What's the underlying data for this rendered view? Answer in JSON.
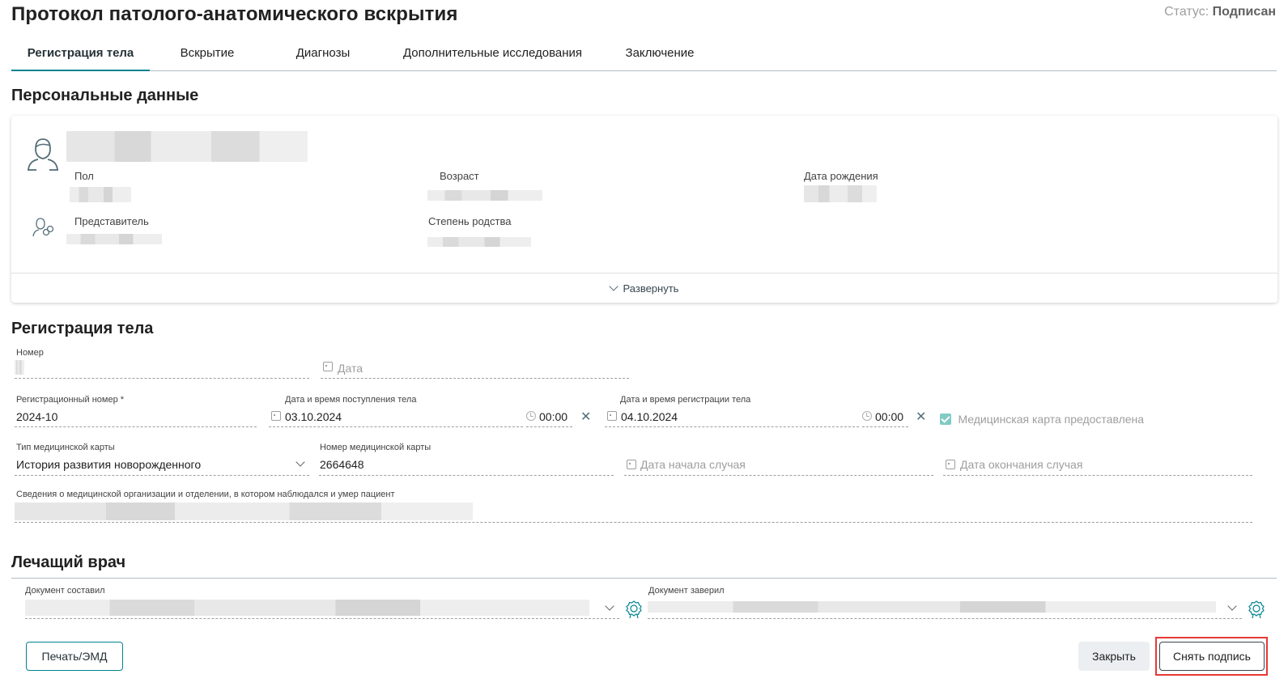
{
  "header": {
    "title": "Протокол патолого-анатомического вскрытия",
    "status_label": "Статус:",
    "status_value": "Подписан"
  },
  "tabs": [
    {
      "label": "Регистрация тела",
      "active": true
    },
    {
      "label": "Вскрытие",
      "active": false
    },
    {
      "label": "Диагнозы",
      "active": false
    },
    {
      "label": "Дополнительные исследования",
      "active": false
    },
    {
      "label": "Заключение",
      "active": false
    }
  ],
  "personal": {
    "section_title": "Персональные данные",
    "sex_label": "Пол",
    "age_label": "Возраст",
    "dob_label": "Дата рождения",
    "representative_label": "Представитель",
    "relation_label": "Степень родства",
    "expand_label": "Развернуть"
  },
  "body_registration": {
    "section_title": "Регистрация тела",
    "number_label": "Номер",
    "date_placeholder": "Дата",
    "reg_number_label": "Регистрационный номер *",
    "reg_number_value": "2024-10",
    "arrival_label": "Дата и время поступления тела",
    "arrival_date": "03.10.2024",
    "arrival_time": "00:00",
    "registration_label": "Дата и время регистрации тела",
    "registration_date": "04.10.2024",
    "registration_time": "00:00",
    "med_card_provided_label": "Медицинская карта предоставлена",
    "med_card_provided": true,
    "card_type_label": "Тип медицинской карты",
    "card_type_value": "История развития новорожденного",
    "card_number_label": "Номер медицинской карты",
    "card_number_value": "2664648",
    "case_start_placeholder": "Дата начала случая",
    "case_end_placeholder": "Дата окончания случая",
    "org_info_label": "Сведения о медицинской организации и отделении, в котором наблюдался и умер пациент"
  },
  "doctor": {
    "section_title": "Лечащий врач",
    "compiled_label": "Документ составил",
    "certified_label": "Документ заверил"
  },
  "footer": {
    "print_label": "Печать/ЭМД",
    "close_label": "Закрыть",
    "unsign_label": "Снять подпись"
  },
  "colors": {
    "accent": "#00838f",
    "highlight": "#e53935"
  }
}
